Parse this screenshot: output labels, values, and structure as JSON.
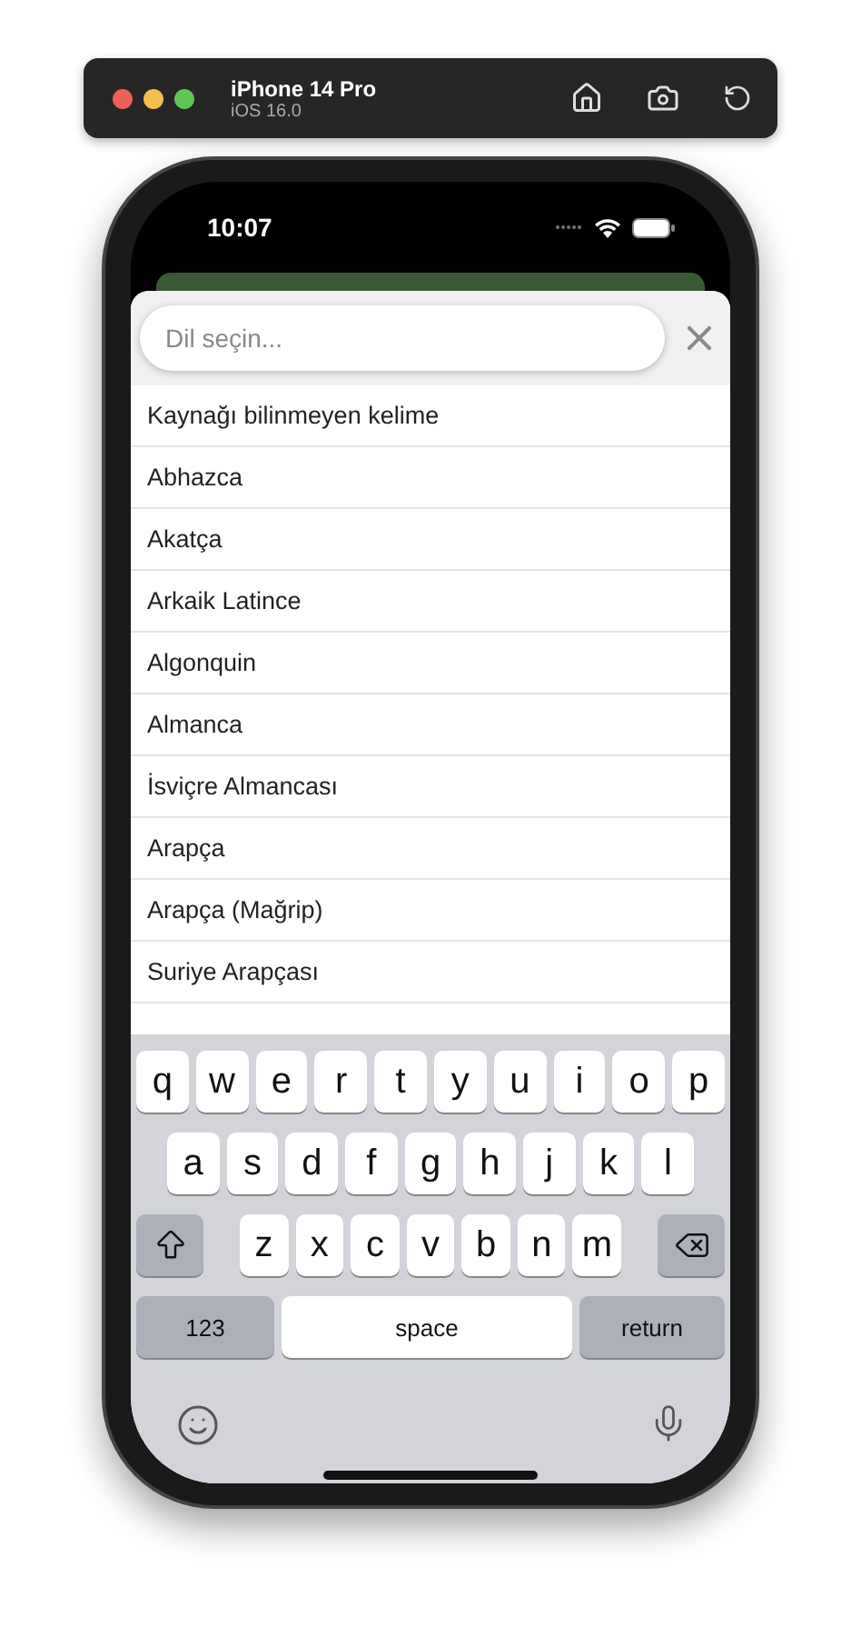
{
  "simulator": {
    "device": "iPhone 14 Pro",
    "os": "iOS 16.0"
  },
  "status_bar": {
    "time": "10:07"
  },
  "search": {
    "placeholder": "Dil seçin..."
  },
  "languages": [
    "Kaynağı bilinmeyen kelime",
    "Abhazca",
    "Akatça",
    "Arkaik Latince",
    "Algonquin",
    "Almanca",
    "İsviçre Almancası",
    "Arapça",
    "Arapça (Mağrip)",
    "Suriye Arapçası"
  ],
  "keyboard": {
    "rows": [
      [
        "q",
        "w",
        "e",
        "r",
        "t",
        "y",
        "u",
        "i",
        "o",
        "p"
      ],
      [
        "a",
        "s",
        "d",
        "f",
        "g",
        "h",
        "j",
        "k",
        "l"
      ],
      [
        "z",
        "x",
        "c",
        "v",
        "b",
        "n",
        "m"
      ]
    ],
    "numbers_key": "123",
    "space_key": "space",
    "return_key": "return"
  }
}
